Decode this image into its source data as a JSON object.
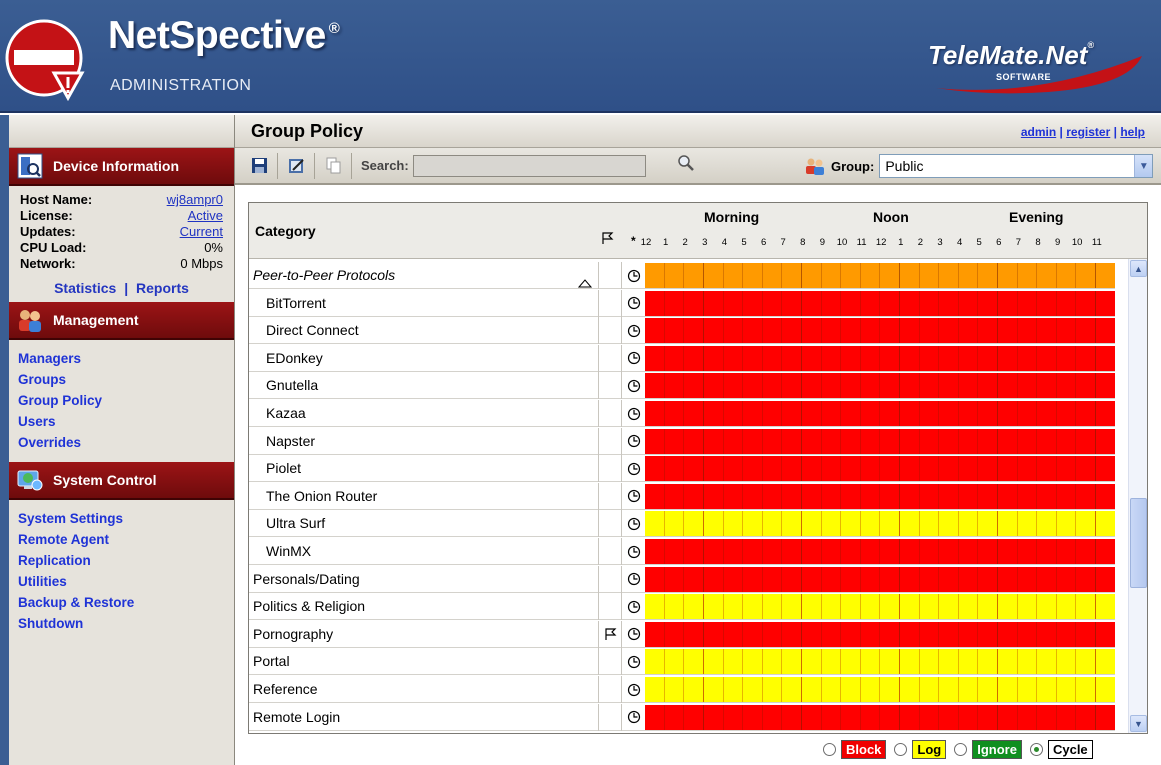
{
  "header": {
    "app_name": "NetSpective",
    "registered_mark": "®",
    "app_subtitle": "ADMINISTRATION",
    "vendor_name": "TeleMate.Net",
    "vendor_mark": "®",
    "vendor_subtitle": "SOFTWARE"
  },
  "sidebar": {
    "device_info": {
      "title": "Device Information",
      "fields": [
        {
          "label": "Host Name:",
          "value": "wj8ampr0"
        },
        {
          "label": "License:",
          "value": "Active"
        },
        {
          "label": "Updates:",
          "value": "Current"
        },
        {
          "label": "CPU Load:",
          "value": "0%"
        },
        {
          "label": "Network:",
          "value": "0 Mbps"
        }
      ],
      "statistics_link": "Statistics",
      "separator": "|",
      "reports_link": "Reports"
    },
    "management": {
      "title": "Management",
      "items": [
        "Managers",
        "Groups",
        "Group Policy",
        "Users",
        "Overrides"
      ]
    },
    "system_control": {
      "title": "System Control",
      "items": [
        "System Settings",
        "Remote Agent",
        "Replication",
        "Utilities",
        "Backup & Restore",
        "Shutdown"
      ]
    }
  },
  "main": {
    "title": "Group Policy",
    "top_links": {
      "admin": "admin",
      "sep": "|",
      "register": "register",
      "help": "help"
    },
    "toolbar": {
      "search_label": "Search:",
      "search_value": "",
      "group_label": "Group:",
      "group_value": "Public"
    }
  },
  "grid": {
    "category_header": "Category",
    "star_header": "*",
    "periods": [
      "Morning",
      "Noon",
      "Evening"
    ],
    "hours": [
      "12",
      "1",
      "2",
      "3",
      "4",
      "5",
      "6",
      "7",
      "8",
      "9",
      "10",
      "11",
      "12",
      "1",
      "2",
      "3",
      "4",
      "5",
      "6",
      "7",
      "8",
      "9",
      "10",
      "11"
    ],
    "rows": [
      {
        "label": "Peer-to-Peer Protocols",
        "level": "parent",
        "flag": false,
        "action": "orange"
      },
      {
        "label": "BitTorrent",
        "level": "sub",
        "flag": false,
        "action": "red"
      },
      {
        "label": "Direct Connect",
        "level": "sub",
        "flag": false,
        "action": "red"
      },
      {
        "label": "EDonkey",
        "level": "sub",
        "flag": false,
        "action": "red"
      },
      {
        "label": "Gnutella",
        "level": "sub",
        "flag": false,
        "action": "red"
      },
      {
        "label": "Kazaa",
        "level": "sub",
        "flag": false,
        "action": "red"
      },
      {
        "label": "Napster",
        "level": "sub",
        "flag": false,
        "action": "red"
      },
      {
        "label": "Piolet",
        "level": "sub",
        "flag": false,
        "action": "red"
      },
      {
        "label": "The Onion Router",
        "level": "sub",
        "flag": false,
        "action": "red"
      },
      {
        "label": "Ultra Surf",
        "level": "sub",
        "flag": false,
        "action": "yellow"
      },
      {
        "label": "WinMX",
        "level": "sub",
        "flag": false,
        "action": "red"
      },
      {
        "label": "Personals/Dating",
        "level": "top",
        "flag": false,
        "action": "red"
      },
      {
        "label": "Politics & Religion",
        "level": "top",
        "flag": false,
        "action": "yellow"
      },
      {
        "label": "Pornography",
        "level": "top",
        "flag": true,
        "action": "red"
      },
      {
        "label": "Portal",
        "level": "top",
        "flag": false,
        "action": "yellow"
      },
      {
        "label": "Reference",
        "level": "top",
        "flag": false,
        "action": "yellow"
      },
      {
        "label": "Remote Login",
        "level": "top",
        "flag": false,
        "action": "red"
      }
    ]
  },
  "legend": {
    "block": "Block",
    "log": "Log",
    "ignore": "Ignore",
    "cycle": "Cycle",
    "selected": "cycle"
  },
  "colors": {
    "header_blue": "#3b5e93",
    "section_red": "#8b0f10",
    "block": "#ff0000",
    "log": "#ffff00",
    "ignore": "#0f8f1f",
    "parent_mixed": "#ff9a00",
    "link": "#1f33d6"
  }
}
